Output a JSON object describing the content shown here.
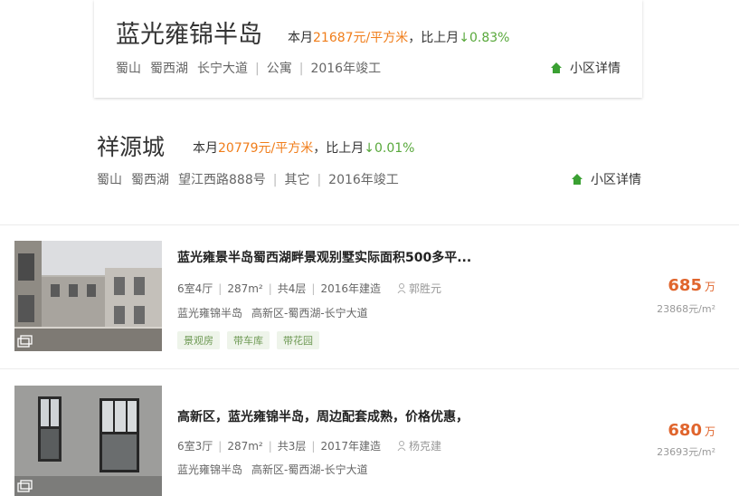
{
  "communities": [
    {
      "name": "蓝光雍锦半岛",
      "price_prefix": "本月",
      "price_value": "21687元/平方米",
      "compare_prefix": "，比上月",
      "compare_arrow": "↓",
      "compare_value": "0.83%",
      "meta": [
        "蜀山",
        "蜀西湖",
        "长宁大道"
      ],
      "type": "公寓",
      "year": "2016年竣工",
      "detail_label": "小区详情"
    },
    {
      "name": "祥源城",
      "price_prefix": "本月",
      "price_value": "20779元/平方米",
      "compare_prefix": "，比上月",
      "compare_arrow": "↓",
      "compare_value": "0.01%",
      "meta": [
        "蜀山",
        "蜀西湖",
        "望江西路888号"
      ],
      "type": "其它",
      "year": "2016年竣工",
      "detail_label": "小区详情"
    }
  ],
  "listings": [
    {
      "title": "蓝光雍景半岛蜀西湖畔景观别墅实际面积500多平...",
      "layout": "6室4厅",
      "area": "287m²",
      "floors": "共4层",
      "built": "2016年建造",
      "agent": "郭胜元",
      "community": "蓝光雍锦半岛",
      "district": "高新区-蜀西湖-长宁大道",
      "tags": [
        "景观房",
        "带车库",
        "带花园"
      ],
      "price": "685",
      "price_unit": "万",
      "unit_price": "23868元/m²"
    },
    {
      "title": "高新区，蓝光雍锦半岛，周边配套成熟，价格优惠，",
      "layout": "6室3厅",
      "area": "287m²",
      "floors": "共3层",
      "built": "2017年建造",
      "agent": "杨克建",
      "community": "蓝光雍锦半岛",
      "district": "高新区-蜀西湖-长宁大道",
      "tags": [],
      "price": "680",
      "price_unit": "万",
      "unit_price": "23693元/m²"
    }
  ],
  "colors": {
    "price_orange": "#f07d1a",
    "drop_green": "#58a83b",
    "listing_price": "#e0652d",
    "tag_green": "#6f9a55"
  }
}
